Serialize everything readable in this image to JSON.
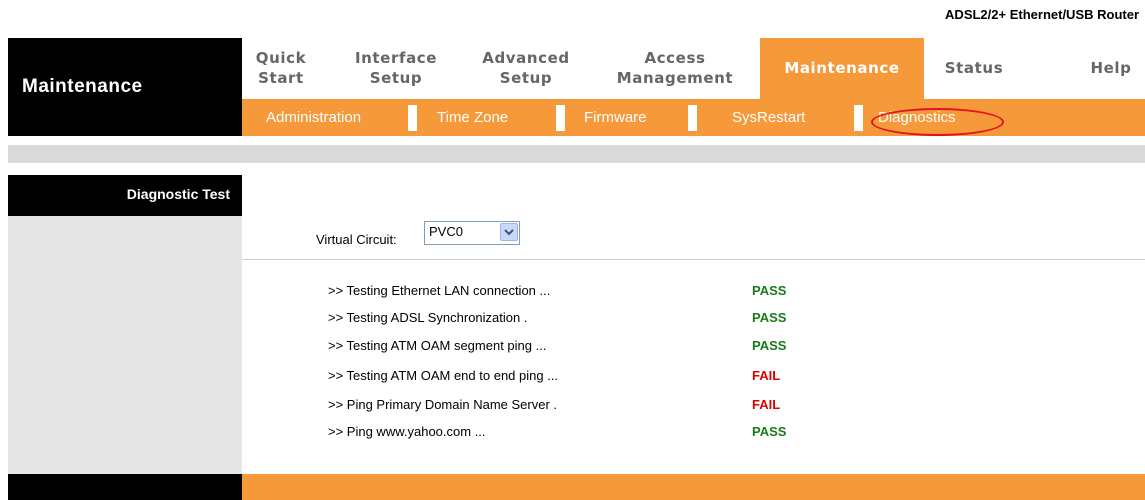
{
  "header": {
    "product": "ADSL2/2+ Ethernet/USB Router"
  },
  "left_title": "Maintenance",
  "tabs": [
    {
      "line1": "Quick",
      "line2": "Start",
      "active": false
    },
    {
      "line1": "Interface",
      "line2": "Setup",
      "active": false
    },
    {
      "line1": "Advanced",
      "line2": "Setup",
      "active": false
    },
    {
      "line1": "Access",
      "line2": "Management",
      "active": false
    },
    {
      "line1": "Maintenance",
      "line2": "",
      "active": true
    },
    {
      "line1": "Status",
      "line2": "",
      "active": false
    },
    {
      "line1": "Help",
      "line2": "",
      "active": false
    }
  ],
  "subtabs": [
    "Administration",
    "Time Zone",
    "Firmware",
    "SysRestart",
    "Diagnostics"
  ],
  "section": {
    "title": "Diagnostic Test"
  },
  "vc": {
    "label": "Virtual Circuit:",
    "value": "PVC0"
  },
  "tests": [
    {
      "label": ">> Testing Ethernet LAN connection ...",
      "result": "PASS"
    },
    {
      "label": ">> Testing ADSL Synchronization .",
      "result": "PASS"
    },
    {
      "label": ">> Testing ATM OAM segment ping ...",
      "result": "PASS"
    },
    {
      "label": ">> Testing ATM OAM end to end ping ...",
      "result": "FAIL"
    },
    {
      "label": ">> Ping Primary Domain Name Server .",
      "result": "FAIL"
    },
    {
      "label": ">> Ping www.yahoo.com ...",
      "result": "PASS"
    }
  ],
  "colors": {
    "accent": "#f5993a",
    "pass": "#1a7a1a",
    "fail": "#e00000",
    "highlight_circle": "#e2121f"
  }
}
